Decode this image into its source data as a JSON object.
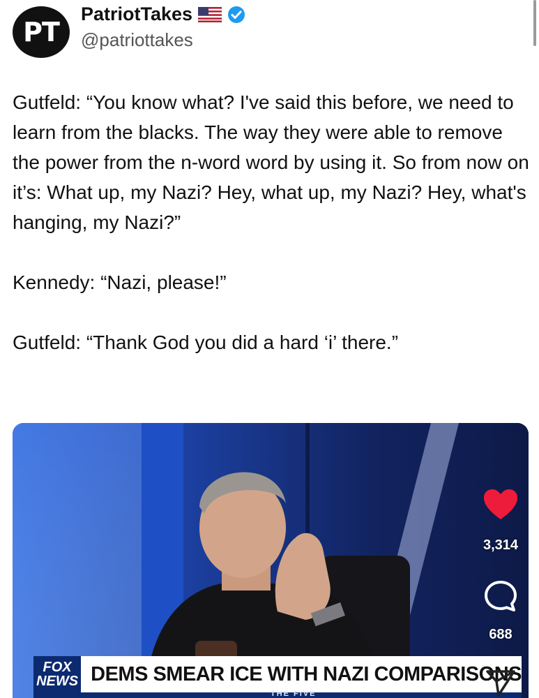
{
  "account": {
    "avatar_text": "PT",
    "display_name": "PatriotTakes",
    "handle": "@patriottakes",
    "flag_icon": "us-flag-icon",
    "verified_icon": "verified-badge-icon"
  },
  "tweet": {
    "lines": [
      "Gutfeld: “You know what? I've said this before, we need to learn from the blacks. The way they were able to remove the power from the n-word word by using it. So from now on it’s: What up, my Nazi? Hey, what up, my Nazi? Hey, what's hanging, my Nazi?”",
      "Kennedy: “Nazi, please!”",
      "Gutfeld: “Thank God you did a hard ‘i’ there.”"
    ]
  },
  "video": {
    "network_logo_line1": "FOX",
    "network_logo_line2": "NEWS",
    "chyron": "DEMS SMEAR ICE WITH NAZI COMPARISONS",
    "show_name": "THE FIVE"
  },
  "actions": {
    "likes": "3,314",
    "comments": "688",
    "like_icon": "heart-icon",
    "comment_icon": "comment-bubble-icon",
    "share_icon": "share-paper-plane-icon"
  },
  "colors": {
    "like_red": "#ef1b3a",
    "fox_blue": "#0b2a70",
    "verified_blue": "#1d9bf0"
  }
}
